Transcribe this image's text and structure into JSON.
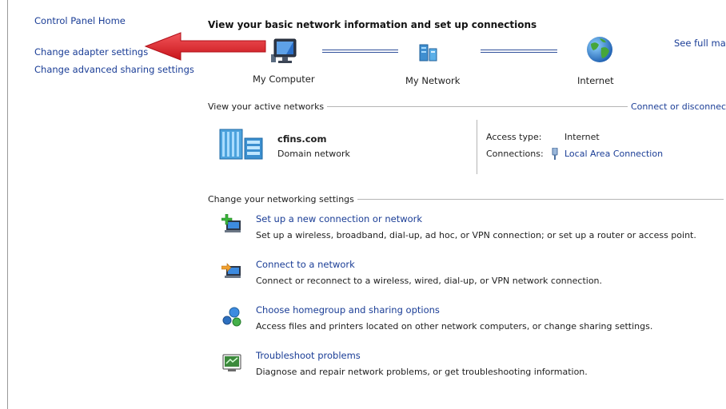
{
  "sidebar": {
    "items": [
      {
        "label": "Control Panel Home"
      },
      {
        "label": "Change adapter settings"
      },
      {
        "label": "Change advanced sharing settings"
      }
    ]
  },
  "main": {
    "title": "View your basic network information and set up connections",
    "see_full_map": "See full map",
    "map": {
      "nodes": [
        {
          "label": "My Computer",
          "icon": "computer-icon"
        },
        {
          "label": "My Network",
          "icon": "network-icon"
        },
        {
          "label": "Internet",
          "icon": "globe-icon"
        }
      ]
    },
    "active_networks": {
      "label": "View your active networks",
      "connect_link": "Connect or disconnect",
      "network_name": "cfins.com",
      "network_type": "Domain network",
      "access_type_label": "Access type:",
      "access_type_value": "Internet",
      "connections_label": "Connections:",
      "connections_value": "Local Area Connection"
    },
    "settings": {
      "label": "Change your networking settings",
      "tasks": [
        {
          "title": "Set up a new connection or network",
          "desc": "Set up a wireless, broadband, dial-up, ad hoc, or VPN connection; or set up a router or access point."
        },
        {
          "title": "Connect to a network",
          "desc": "Connect or reconnect to a wireless, wired, dial-up, or VPN network connection."
        },
        {
          "title": "Choose homegroup and sharing options",
          "desc": "Access files and printers located on other network computers, or change sharing settings."
        },
        {
          "title": "Troubleshoot problems",
          "desc": "Diagnose and repair network problems, or get troubleshooting information."
        }
      ]
    }
  },
  "colors": {
    "link": "#1a3d96",
    "arrow": "#e8242a"
  }
}
